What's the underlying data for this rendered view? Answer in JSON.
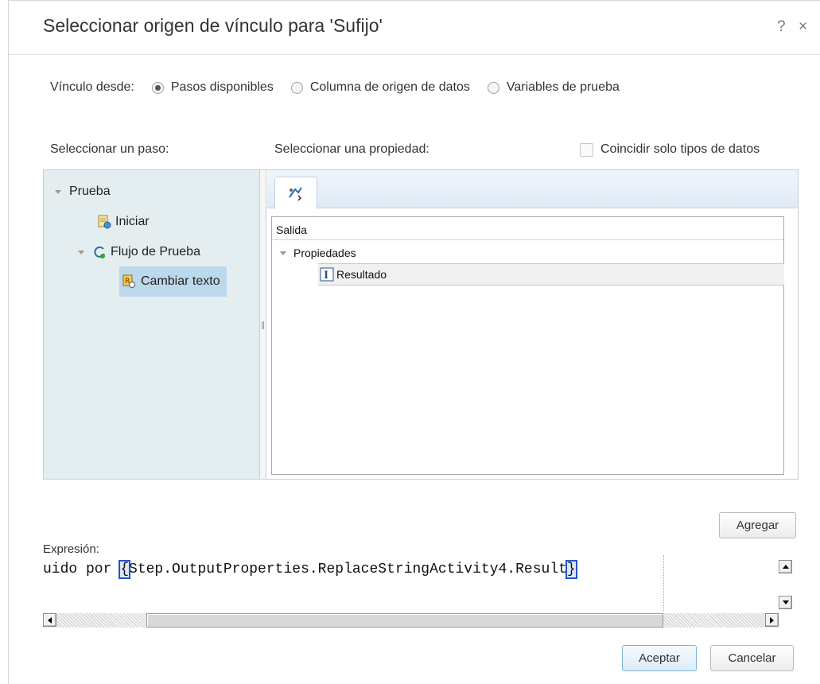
{
  "dialog": {
    "title": "Seleccionar origen de vínculo para 'Sufijo'",
    "help_symbol": "?",
    "close_symbol": "×"
  },
  "link_from": {
    "label": "Vínculo desde:",
    "options": [
      {
        "label": "Pasos disponibles",
        "checked": true
      },
      {
        "label": "Columna de origen de datos",
        "checked": false
      },
      {
        "label": "Variables de prueba",
        "checked": false
      }
    ]
  },
  "step_label": "Seleccionar un paso:",
  "property_label": "Seleccionar una propiedad:",
  "match_types": {
    "label": "Coincidir solo tipos de datos",
    "checked": false
  },
  "tree": {
    "root": "Prueba",
    "start": "Iniciar",
    "flow": "Flujo de Prueba",
    "selected_step": "Cambiar texto"
  },
  "properties": {
    "tab_icon": "output-properties-icon",
    "header": "Salida",
    "group": "Propiedades",
    "item": "Resultado"
  },
  "buttons": {
    "add": "Agregar",
    "ok": "Aceptar",
    "cancel": "Cancelar"
  },
  "expression": {
    "label": "Expresión:",
    "prefix": "uido por ",
    "open_brace": "{",
    "body": "Step.OutputProperties.ReplaceStringActivity4.Result",
    "close_brace": "}"
  },
  "colors": {
    "tree_bg": "#e4eef0",
    "selection": "#bcd8ec",
    "primary_border": "#7eb3d8",
    "brace_highlight": "#2255cc"
  }
}
